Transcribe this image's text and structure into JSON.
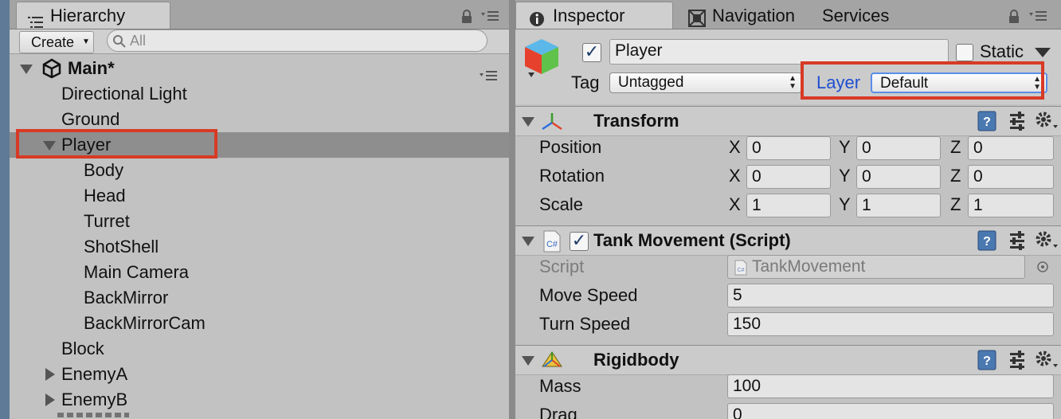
{
  "hierarchy": {
    "tab_label": "Hierarchy",
    "create_label": "Create",
    "search_placeholder": "All",
    "scene_name": "Main*",
    "items": [
      {
        "label": "Directional Light"
      },
      {
        "label": "Ground"
      },
      {
        "label": "Player"
      },
      {
        "label": "Body"
      },
      {
        "label": "Head"
      },
      {
        "label": "Turret"
      },
      {
        "label": "ShotShell"
      },
      {
        "label": "Main Camera"
      },
      {
        "label": "BackMirror"
      },
      {
        "label": "BackMirrorCam"
      },
      {
        "label": "Block"
      },
      {
        "label": "EnemyA"
      },
      {
        "label": "EnemyB"
      }
    ],
    "selected_item": "Player"
  },
  "inspector": {
    "tabs": [
      {
        "label": "Inspector"
      },
      {
        "label": "Navigation"
      },
      {
        "label": "Services"
      }
    ],
    "object_name": "Player",
    "static_label": "Static",
    "tag_label": "Tag",
    "tag_value": "Untagged",
    "layer_label": "Layer",
    "layer_value": "Default",
    "transform": {
      "title": "Transform",
      "rows": [
        {
          "label": "Position",
          "x": "0",
          "y": "0",
          "z": "0"
        },
        {
          "label": "Rotation",
          "x": "0",
          "y": "0",
          "z": "0"
        },
        {
          "label": "Scale",
          "x": "1",
          "y": "1",
          "z": "1"
        }
      ],
      "axis_labels": [
        "X",
        "Y",
        "Z"
      ]
    },
    "tank_movement": {
      "title": "Tank Movement (Script)",
      "script_label": "Script",
      "script_value": "TankMovement",
      "move_speed_label": "Move Speed",
      "move_speed_value": "5",
      "turn_speed_label": "Turn Speed",
      "turn_speed_value": "150"
    },
    "rigidbody": {
      "title": "Rigidbody",
      "mass_label": "Mass",
      "mass_value": "100",
      "drag_label": "Drag",
      "drag_value": "0"
    }
  },
  "colors": {
    "highlight": "#d83a25",
    "layer_label": "#1f4fd0",
    "selection": "#8e8e8e"
  }
}
